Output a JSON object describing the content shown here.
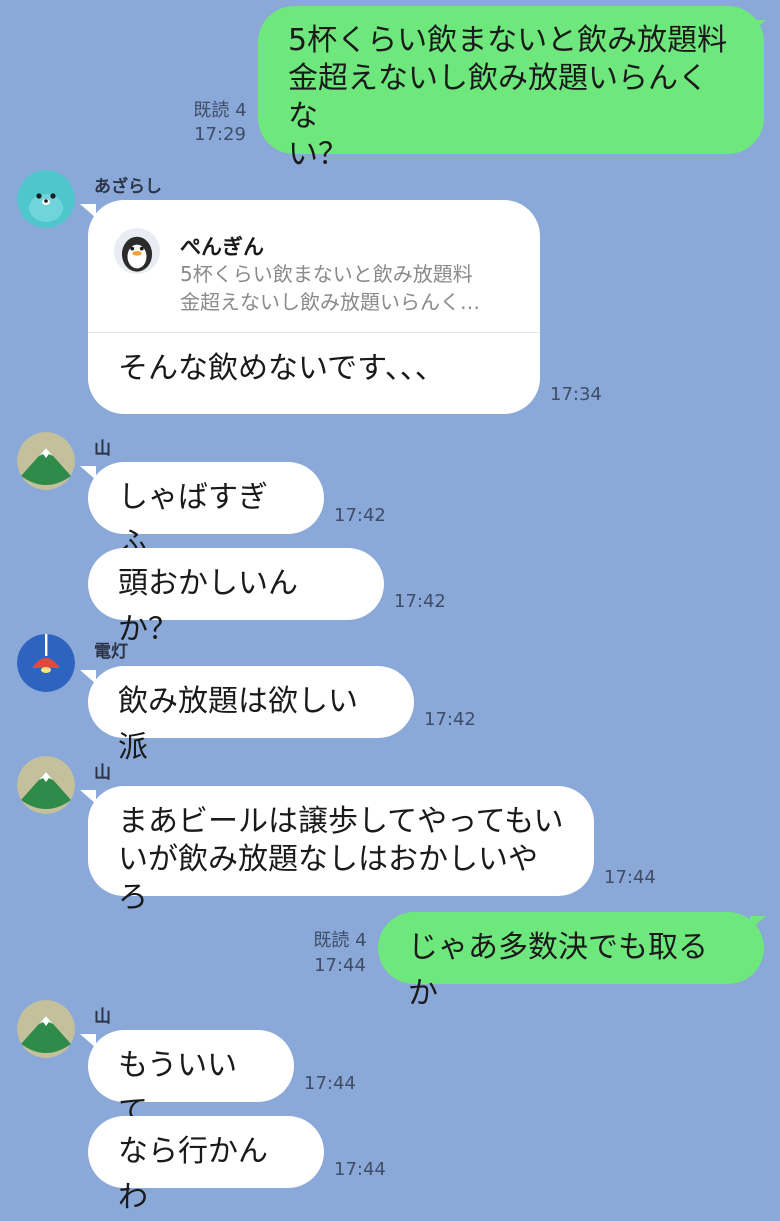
{
  "colors": {
    "background": "#8aa8d8",
    "outgoing_bubble": "#6ee77c",
    "incoming_bubble": "#ffffff"
  },
  "messages": [
    {
      "sender": "",
      "text_lines": [
        "5杯くらい飲まないと飲み放題料",
        "金超えないし飲み放題いらんくな",
        "い？"
      ],
      "read": "既読 4",
      "time": "17:29"
    },
    {
      "sender": "あざらし",
      "avatar_icon": "seal-icon",
      "reply_to": {
        "name": "ぺんぎん",
        "avatar_icon": "penguin-icon",
        "lines": [
          "5杯くらい飲まないと飲み放題料",
          "金超えないし飲み放題いらんく…"
        ]
      },
      "text": "そんな飲めないです、、、",
      "time": "17:34"
    },
    {
      "sender": "山",
      "avatar_icon": "mountain-icon",
      "text": "しゃばすぎふ",
      "time": "17:42"
    },
    {
      "sender": "",
      "text": "頭おかしいんか？",
      "time": "17:42"
    },
    {
      "sender": "電灯",
      "avatar_icon": "lamp-icon",
      "text": "飲み放題は欲しい派",
      "time": "17:42"
    },
    {
      "sender": "山",
      "avatar_icon": "mountain-icon",
      "text_lines": [
        "まあビールは譲歩してやってもい",
        "いが飲み放題なしはおかしいやろ"
      ],
      "time": "17:44"
    },
    {
      "sender": "",
      "text": "じゃあ多数決でも取るか",
      "read": "既読 4",
      "time": "17:44"
    },
    {
      "sender": "山",
      "avatar_icon": "mountain-icon",
      "text": "もういいて",
      "time": "17:44"
    },
    {
      "sender": "",
      "text": "なら行かんわ",
      "time": "17:44"
    }
  ]
}
